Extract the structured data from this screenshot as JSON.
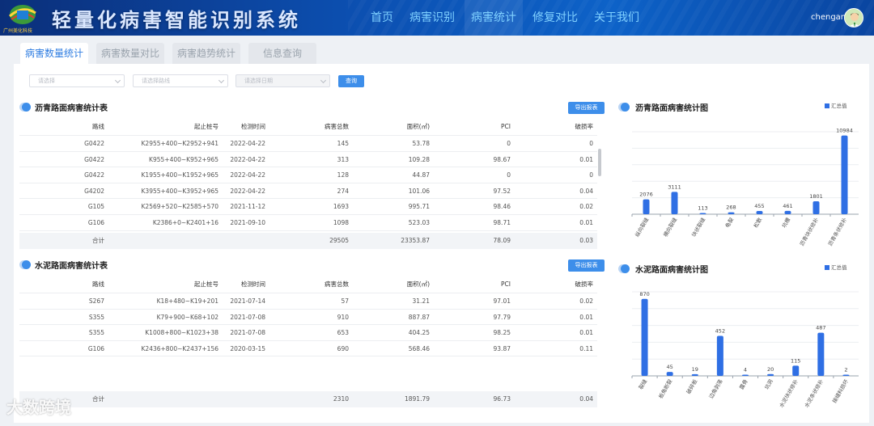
{
  "header": {
    "title": "轻量化病害智能识别系统",
    "logo_text": "广州美化科技",
    "nav": [
      "首页",
      "病害识别",
      "病害统计",
      "修复对比",
      "关于我们"
    ],
    "active_nav": 2,
    "username": "chengan"
  },
  "tabs": [
    "病害数量统计",
    "病害数量对比",
    "病害趋势统计",
    "信息查询"
  ],
  "filters": {
    "placeholders": [
      "请选择",
      "请选择路线",
      "请选择日期"
    ],
    "query_label": "查询"
  },
  "asphalt_table": {
    "title": "沥青路面病害统计表",
    "export_label": "导出报表",
    "columns": [
      "路线",
      "起止桩号",
      "检测时间",
      "病害总数",
      "面积(㎡)",
      "PCI",
      "破损率"
    ],
    "rows": [
      [
        "G0422",
        "K2955+400~K2952+941",
        "2022-04-22",
        "145",
        "53.78",
        "0",
        "0"
      ],
      [
        "G0422",
        "K955+400~K952+965",
        "2022-04-22",
        "313",
        "109.28",
        "98.67",
        "0.01"
      ],
      [
        "G0422",
        "K1955+400~K1952+965",
        "2022-04-22",
        "128",
        "44.87",
        "0",
        "0"
      ],
      [
        "G4202",
        "K3955+400~K3952+965",
        "2022-04-22",
        "274",
        "101.06",
        "97.52",
        "0.04"
      ],
      [
        "G105",
        "K2569+520~K2585+570",
        "2021-11-12",
        "1693",
        "995.71",
        "98.46",
        "0.02"
      ],
      [
        "G106",
        "K2386+0~K2401+16",
        "2021-09-10",
        "1098",
        "523.03",
        "98.71",
        "0.01"
      ]
    ],
    "total": [
      "合计",
      "",
      "",
      "29505",
      "23353.87",
      "78.09",
      "0.03"
    ]
  },
  "cement_table": {
    "title": "水泥路面病害统计表",
    "export_label": "导出报表",
    "columns": [
      "路线",
      "起止桩号",
      "检测时间",
      "病害总数",
      "面积(㎡)",
      "PCI",
      "破损率"
    ],
    "rows": [
      [
        "S267",
        "K18+480~K19+201",
        "2021-07-14",
        "57",
        "31.21",
        "97.01",
        "0.02"
      ],
      [
        "S355",
        "K79+900~K68+102",
        "2021-07-08",
        "910",
        "887.87",
        "97.79",
        "0.01"
      ],
      [
        "S355",
        "K1008+800~K1023+38",
        "2021-07-08",
        "653",
        "404.25",
        "98.25",
        "0.01"
      ],
      [
        "G106",
        "K2436+800~K2437+156",
        "2020-03-15",
        "690",
        "568.46",
        "93.87",
        "0.11"
      ]
    ],
    "total": [
      "合计",
      "",
      "",
      "2310",
      "1891.79",
      "96.73",
      "0.04"
    ]
  },
  "chart_data": [
    {
      "type": "bar",
      "title": "沥青路面病害统计图",
      "legend": "汇总值",
      "legend_position": "top-right",
      "categories": [
        "纵向裂缝",
        "横向裂缝",
        "块状裂缝",
        "龟裂",
        "松散",
        "坑槽",
        "沥青块状修补",
        "沥青条状修补"
      ],
      "values": [
        2076,
        3111,
        113,
        268,
        455,
        461,
        1801,
        10984
      ],
      "ylim": [
        0,
        11500
      ],
      "grid": true,
      "color": "#2f6fe4"
    },
    {
      "type": "bar",
      "title": "水泥路面病害统计图",
      "legend": "汇总值",
      "legend_position": "top-right",
      "categories": [
        "裂缝",
        "板角断裂",
        "破碎板",
        "边角剥落",
        "露骨",
        "坑洞",
        "水泥块状修补",
        "水泥条状修补",
        "接缝料损坏"
      ],
      "values": [
        870,
        45,
        19,
        452,
        4,
        20,
        115,
        487,
        2
      ],
      "ylim": [
        0,
        950
      ],
      "grid": true,
      "color": "#2f6fe4"
    }
  ],
  "watermark": "大数跨境"
}
